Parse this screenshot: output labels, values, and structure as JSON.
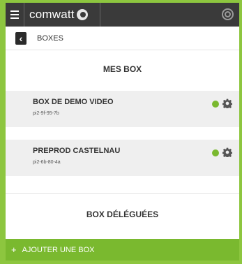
{
  "header": {
    "logo_text": "comwatt",
    "menu_icon": "hamburger-menu-icon",
    "help_icon": "help-icon"
  },
  "breadcrumb": {
    "back_icon": "chevron-left-icon",
    "label": "BOXES"
  },
  "sections": {
    "mine_title": "MES BOX",
    "delegated_title": "BOX DÉLÉGUÉES"
  },
  "boxes": [
    {
      "name": "BOX DE DEMO VIDEO",
      "id": "pi2-9f-95-7b",
      "status_color": "#7ab92f"
    },
    {
      "name": "PREPROD CASTELNAU",
      "id": "pi2-6b-80-4a",
      "status_color": "#7ab92f"
    }
  ],
  "actions": {
    "add_plus": "+",
    "add_label": "AJOUTER UNE BOX"
  },
  "colors": {
    "accent": "#8dc63f",
    "topbar": "#3a3a3a",
    "button": "#7ab92f"
  }
}
